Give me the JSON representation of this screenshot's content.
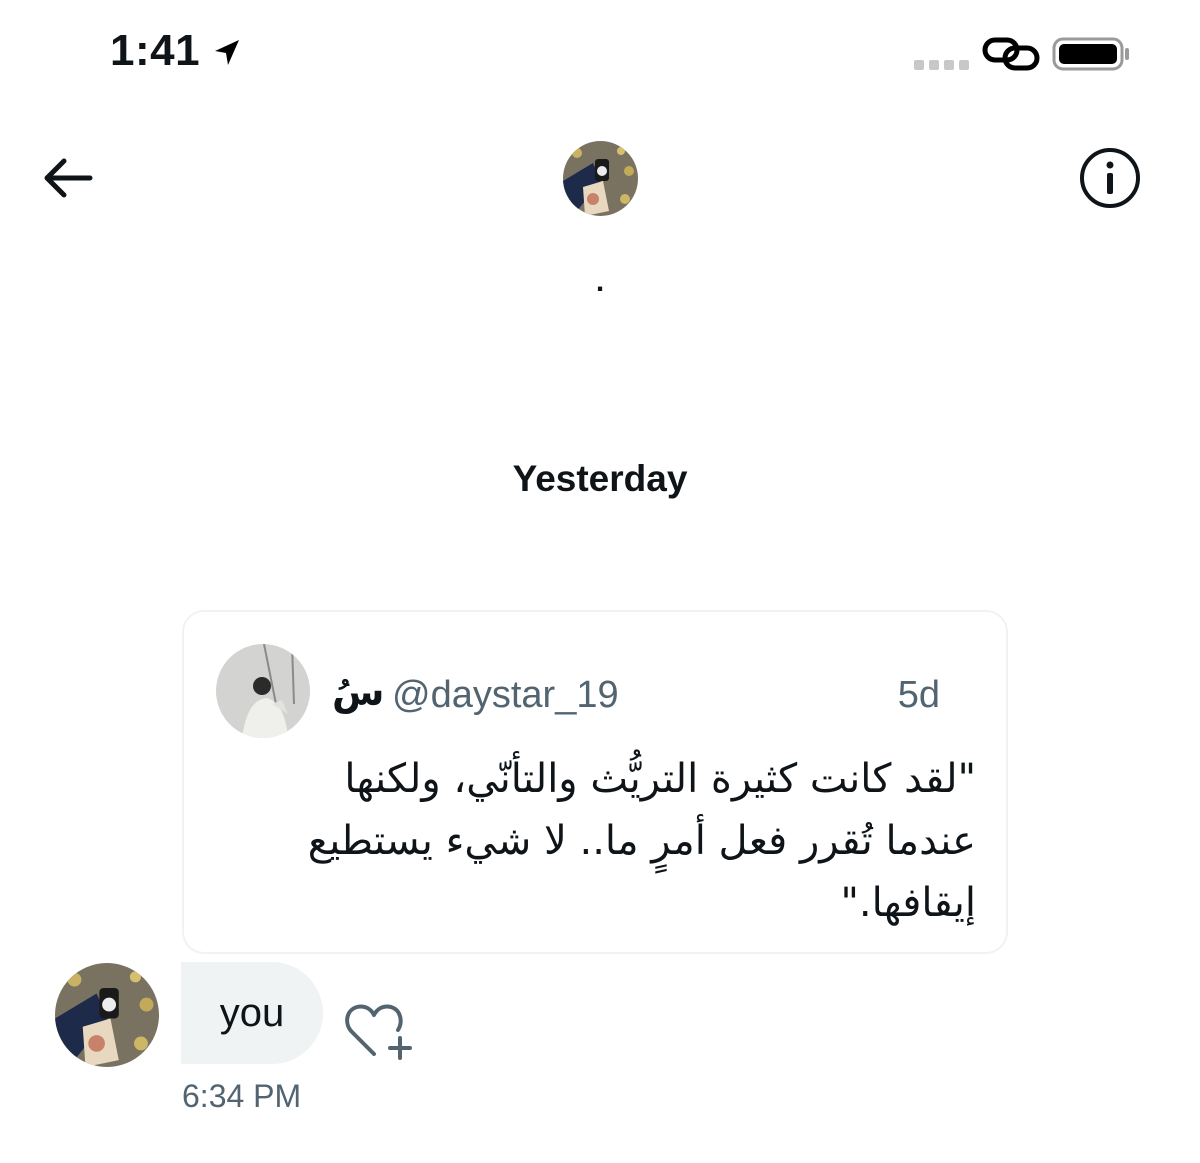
{
  "status_bar": {
    "time": "1:41",
    "icons": [
      "location-arrow-icon",
      "signal-dots-icon",
      "link-icon",
      "battery-icon"
    ]
  },
  "header": {
    "back_icon": "back-arrow-icon",
    "info_icon": "info-icon",
    "name": "."
  },
  "date_separator": "Yesterday",
  "quoted_tweet": {
    "author_name": "سُ",
    "handle": "@daystar_19",
    "age": "5d",
    "text": "\"لقد كانت كثيرة التريُّث والتأنّي، ولكنها عندما تُقرر فعل أمرٍ ما.. لا شيء يستطيع إيقافها.\""
  },
  "message": {
    "text": "you",
    "time": "6:34 PM",
    "react_icon": "add-reaction-heart-icon"
  },
  "colors": {
    "text_primary": "#0f1419",
    "text_secondary": "#536471",
    "bubble_bg": "#eff3f4",
    "card_border": "#eff3f4"
  }
}
